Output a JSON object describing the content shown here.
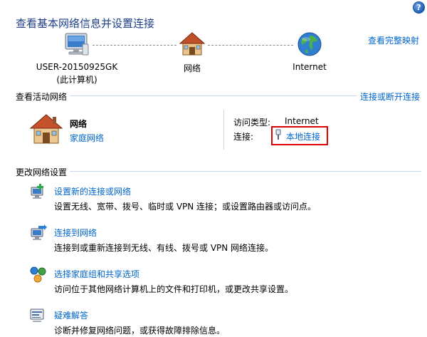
{
  "header": {
    "title": "查看基本网络信息并设置连接",
    "full_map_link": "查看完整映射",
    "help_glyph": "?"
  },
  "network_map": {
    "computer_name": "USER-20150925GK",
    "computer_sub": "(此计算机)",
    "network_label": "网络",
    "internet_label": "Internet"
  },
  "active_networks": {
    "section_title": "查看活动网络",
    "connect_link": "连接或断开连接",
    "network_name": "网络",
    "network_type": "家庭网络",
    "access_type_label": "访问类型:",
    "access_type_value": "Internet",
    "connections_label": "连接:",
    "connection_link": "本地连接"
  },
  "change_settings": {
    "section_title": "更改网络设置",
    "tasks": [
      {
        "title": "设置新的连接或网络",
        "desc": "设置无线、宽带、拨号、临时或 VPN 连接；或设置路由器或访问点。"
      },
      {
        "title": "连接到网络",
        "desc": "连接到或重新连接到无线、有线、拨号或 VPN 网络连接。"
      },
      {
        "title": "选择家庭组和共享选项",
        "desc": "访问位于其他网络计算机上的文件和打印机，或更改共享设置。"
      },
      {
        "title": "疑难解答",
        "desc": "诊断并修复网络问题，或获得故障排除信息。"
      }
    ]
  },
  "colors": {
    "link": "#0066cc",
    "title": "#1e3f8a",
    "highlight": "#e00000"
  }
}
